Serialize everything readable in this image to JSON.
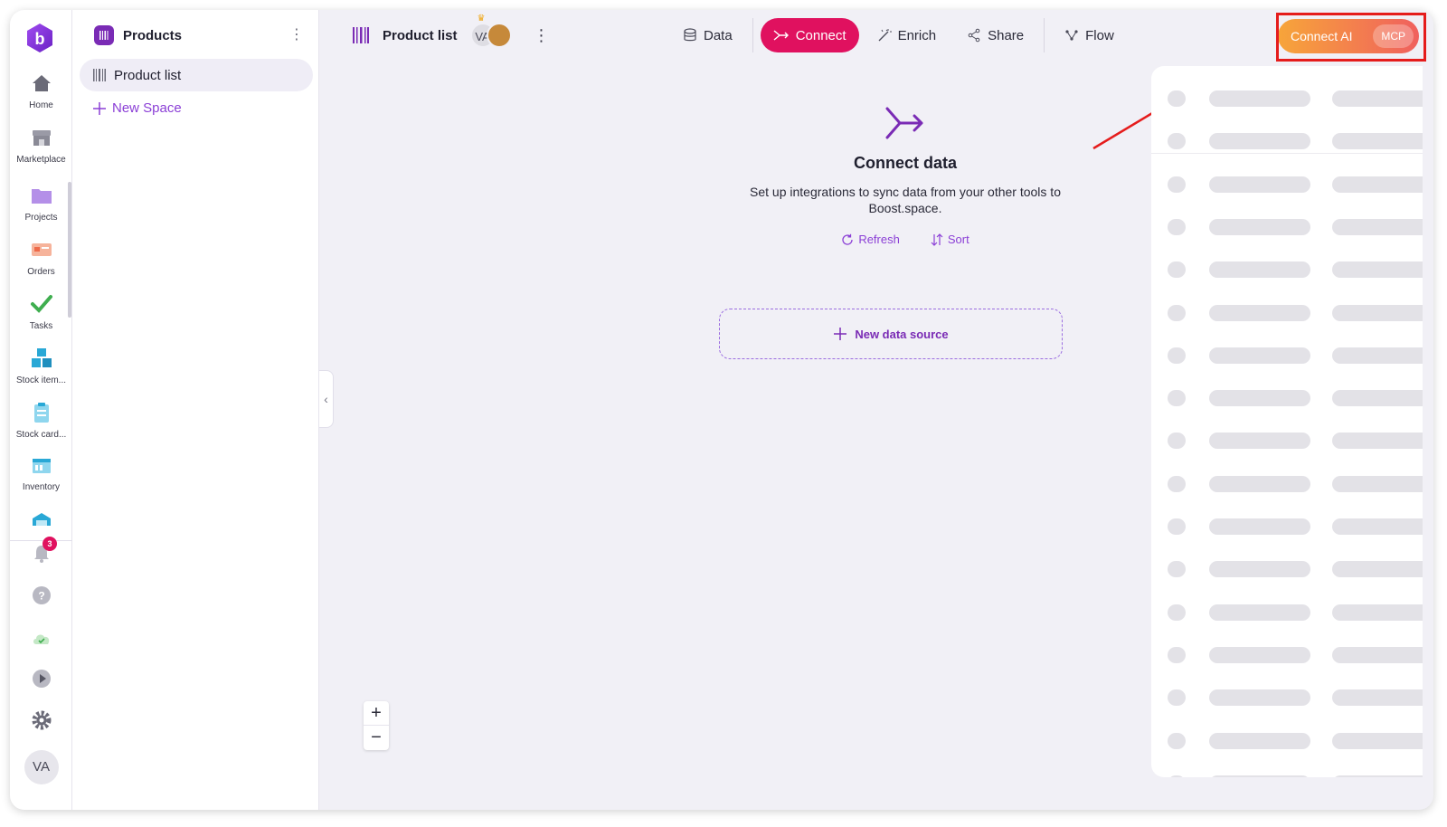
{
  "rail": {
    "items": [
      {
        "label": "Home",
        "icon": "home-icon",
        "color": "#6b6b78"
      },
      {
        "label": "Marketplace",
        "icon": "store-icon",
        "color": "#8a8a96"
      },
      {
        "label": "Projects",
        "icon": "folder-icon",
        "color": "#b48fe8"
      },
      {
        "label": "Orders",
        "icon": "orders-icon",
        "color": "#f08a6a"
      },
      {
        "label": "Tasks",
        "icon": "check-icon",
        "color": "#3fae4f"
      },
      {
        "label": "Stock item...",
        "icon": "boxes-icon",
        "color": "#29a8d6"
      },
      {
        "label": "Stock card...",
        "icon": "clipboard-icon",
        "color": "#29a8d6"
      },
      {
        "label": "Inventory",
        "icon": "inventory-icon",
        "color": "#29a8d6"
      }
    ],
    "notifications_count": "3",
    "user_initials": "VA"
  },
  "sidebar": {
    "title": "Products",
    "items": [
      {
        "label": "Product list"
      }
    ],
    "new_space_label": "New Space"
  },
  "header": {
    "title": "Product list",
    "collaborator_initials": "VA",
    "tabs": [
      {
        "label": "Data",
        "active": false
      },
      {
        "label": "Connect",
        "active": true
      },
      {
        "label": "Enrich",
        "active": false
      },
      {
        "label": "Share",
        "active": false
      },
      {
        "label": "Flow",
        "active": false
      }
    ],
    "connect_ai_label": "Connect AI",
    "mcp_label": "MCP"
  },
  "main": {
    "heading": "Connect data",
    "description": "Set up integrations to sync data from your other tools to Boost.space.",
    "refresh_label": "Refresh",
    "sort_label": "Sort",
    "new_source_label": "New data source"
  },
  "colors": {
    "accent": "#e0115f",
    "brand_purple": "#7a2bb5",
    "link_purple": "#8b3fd6",
    "annotation_red": "#e51c1c"
  }
}
